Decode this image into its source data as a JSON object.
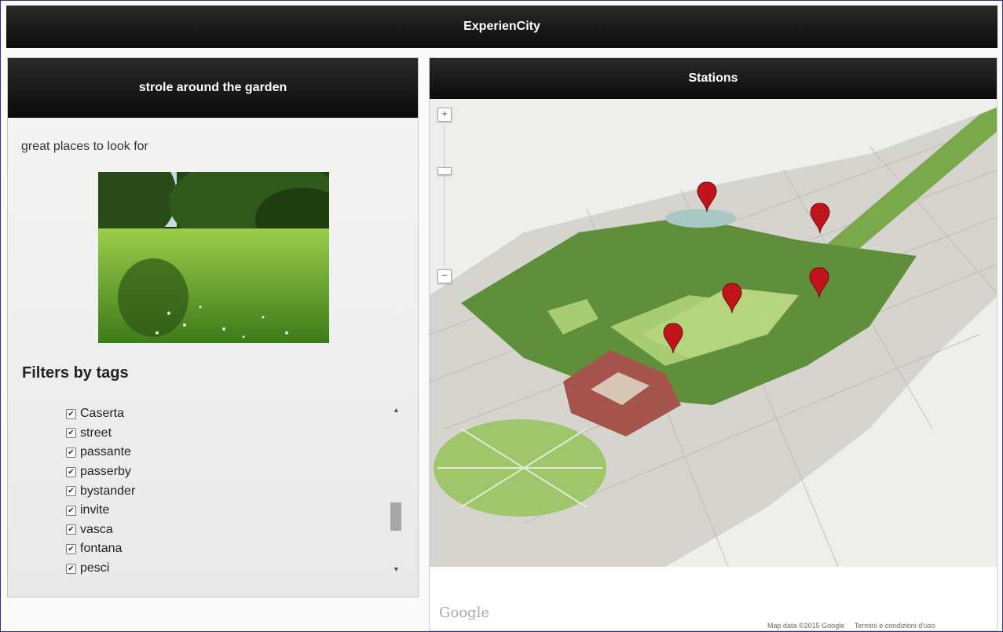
{
  "app": {
    "title": "ExperienCity"
  },
  "left": {
    "header": "strole around the garden",
    "description": "great places to look for",
    "photo_icon": "garden-photo",
    "filters_title": "Filters by tags",
    "tags": [
      {
        "label": "Caserta",
        "checked": true
      },
      {
        "label": "street",
        "checked": true
      },
      {
        "label": "passante",
        "checked": true
      },
      {
        "label": "passerby",
        "checked": true
      },
      {
        "label": "bystander",
        "checked": true
      },
      {
        "label": "invite",
        "checked": true
      },
      {
        "label": "vasca",
        "checked": true
      },
      {
        "label": "fontana",
        "checked": true
      },
      {
        "label": "pesci",
        "checked": true
      }
    ]
  },
  "right": {
    "header": "Stations",
    "zoom_in": "+",
    "zoom_out": "−",
    "google_logo": "Google",
    "map_data": "Map data ©2015 Google",
    "terms": "Termini e condizioni d'uso",
    "marker_icon": "map-marker-icon"
  },
  "colors": {
    "bar": "#111111",
    "marker": "#c0131b",
    "lawn": "#9ec86a",
    "trees": "#5a8a3a"
  }
}
